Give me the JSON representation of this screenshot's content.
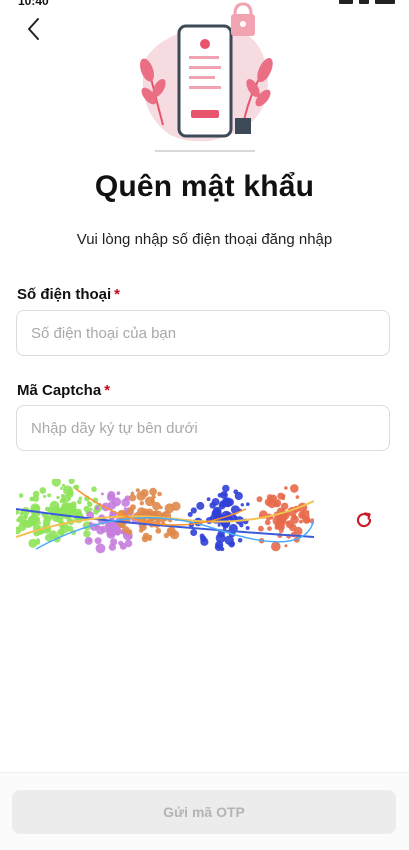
{
  "status_bar": {
    "time": "10:40"
  },
  "header": {
    "back_icon": "chevron-left-icon"
  },
  "hero": {
    "illustration": "phone-form-with-plants-and-lock"
  },
  "page": {
    "title": "Quên mật khẩu",
    "subtitle": "Vui lòng nhập số điện thoại đăng nhập"
  },
  "form": {
    "phone": {
      "label": "Số điện thoại",
      "required_mark": "*",
      "placeholder": "Số điện thoại của bạn",
      "value": ""
    },
    "captcha": {
      "label": "Mã Captcha",
      "required_mark": "*",
      "placeholder": "Nhập dãy ký tự bên dưới",
      "value": "",
      "refresh_icon": "refresh-icon"
    }
  },
  "footer": {
    "submit_label": "Gửi mã OTP",
    "submit_enabled": false
  },
  "colors": {
    "required": "#d0021b",
    "accent": "#e8546d",
    "button_disabled_bg": "#ececec",
    "button_disabled_text": "#b4b4b4"
  }
}
